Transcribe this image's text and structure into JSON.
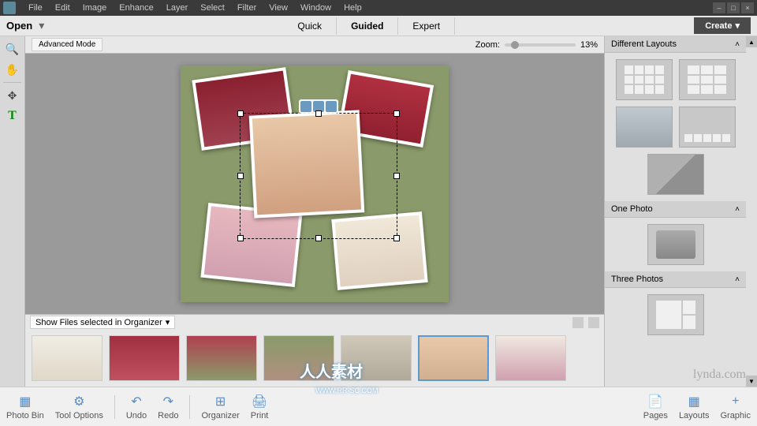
{
  "menu": {
    "items": [
      "File",
      "Edit",
      "Image",
      "Enhance",
      "Layer",
      "Select",
      "Filter",
      "View",
      "Window",
      "Help"
    ]
  },
  "toolbar": {
    "open": "Open",
    "modes": [
      "Quick",
      "Guided",
      "Expert"
    ],
    "active_mode": "Guided",
    "create": "Create"
  },
  "center": {
    "advanced_mode": "Advanced Mode",
    "zoom_label": "Zoom:",
    "zoom_value": "13%"
  },
  "photo_bin": {
    "dropdown": "Show Files selected in Organizer"
  },
  "right": {
    "sections": [
      {
        "title": "Different Layouts"
      },
      {
        "title": "One Photo"
      },
      {
        "title": "Three Photos"
      }
    ]
  },
  "bottom": {
    "items": [
      "Photo Bin",
      "Tool Options",
      "Undo",
      "Redo",
      "Organizer",
      "Print"
    ],
    "right_items": [
      "Pages",
      "Layouts",
      "Graphic"
    ]
  },
  "watermark": {
    "brand": "lynda.com",
    "cn": "人人素材",
    "url": "WWW.RR-SC.COM"
  }
}
